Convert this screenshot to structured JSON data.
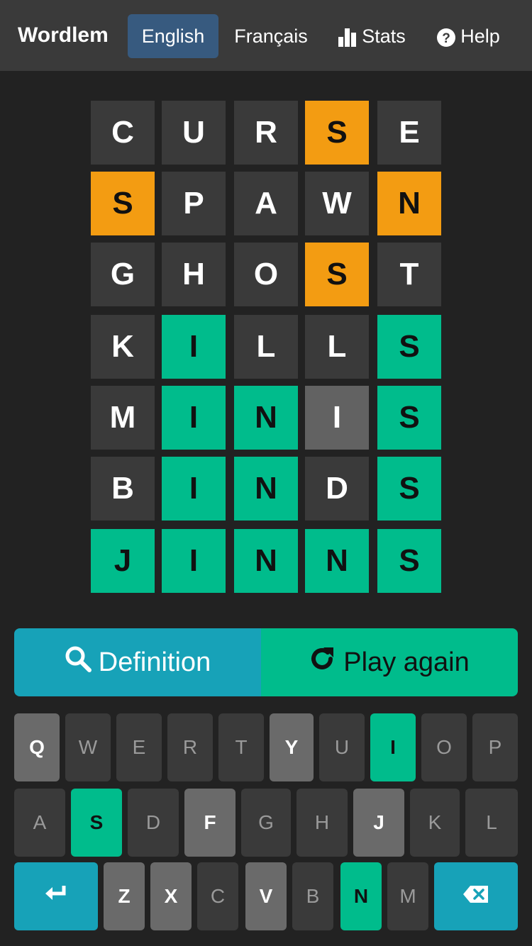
{
  "navbar": {
    "brand": "Wordlem",
    "links": [
      {
        "label": "English"
      },
      {
        "label": "Français"
      },
      {
        "label": "Stats",
        "icon": "bar-chart-icon"
      },
      {
        "label": "Help",
        "icon": "question-circle-icon"
      }
    ]
  },
  "board": {
    "rows": [
      [
        {
          "l": "C",
          "s": "absent"
        },
        {
          "l": "U",
          "s": "absent"
        },
        {
          "l": "R",
          "s": "absent"
        },
        {
          "l": "S",
          "s": "present"
        },
        {
          "l": "E",
          "s": "absent"
        }
      ],
      [
        {
          "l": "S",
          "s": "present"
        },
        {
          "l": "P",
          "s": "absent"
        },
        {
          "l": "A",
          "s": "absent"
        },
        {
          "l": "W",
          "s": "absent"
        },
        {
          "l": "N",
          "s": "present"
        }
      ],
      [
        {
          "l": "G",
          "s": "absent"
        },
        {
          "l": "H",
          "s": "absent"
        },
        {
          "l": "O",
          "s": "absent"
        },
        {
          "l": "S",
          "s": "present"
        },
        {
          "l": "T",
          "s": "absent"
        }
      ],
      [
        {
          "l": "K",
          "s": "absent"
        },
        {
          "l": "I",
          "s": "correct"
        },
        {
          "l": "L",
          "s": "absent"
        },
        {
          "l": "L",
          "s": "absent"
        },
        {
          "l": "S",
          "s": "correct"
        }
      ],
      [
        {
          "l": "M",
          "s": "absent"
        },
        {
          "l": "I",
          "s": "correct"
        },
        {
          "l": "N",
          "s": "correct"
        },
        {
          "l": "I",
          "s": "filled"
        },
        {
          "l": "S",
          "s": "correct"
        }
      ],
      [
        {
          "l": "B",
          "s": "absent"
        },
        {
          "l": "I",
          "s": "correct"
        },
        {
          "l": "N",
          "s": "correct"
        },
        {
          "l": "D",
          "s": "absent"
        },
        {
          "l": "S",
          "s": "correct"
        }
      ],
      [
        {
          "l": "J",
          "s": "correct"
        },
        {
          "l": "I",
          "s": "correct"
        },
        {
          "l": "N",
          "s": "correct"
        },
        {
          "l": "N",
          "s": "correct"
        },
        {
          "l": "S",
          "s": "correct"
        }
      ]
    ]
  },
  "actions": {
    "definition_label": "Definition",
    "definition_icon": "search-icon",
    "play_again_label": "Play again",
    "play_again_icon": "redo-icon"
  },
  "keyboard": {
    "rows": [
      [
        {
          "k": "Q",
          "s": "used"
        },
        {
          "k": "W",
          "s": "absent"
        },
        {
          "k": "E",
          "s": "absent"
        },
        {
          "k": "R",
          "s": "absent"
        },
        {
          "k": "T",
          "s": "absent"
        },
        {
          "k": "Y",
          "s": "used"
        },
        {
          "k": "U",
          "s": "absent"
        },
        {
          "k": "I",
          "s": "correct"
        },
        {
          "k": "O",
          "s": "absent"
        },
        {
          "k": "P",
          "s": "absent"
        }
      ],
      [
        {
          "k": "A",
          "s": "absent"
        },
        {
          "k": "S",
          "s": "correct"
        },
        {
          "k": "D",
          "s": "absent"
        },
        {
          "k": "F",
          "s": "used"
        },
        {
          "k": "G",
          "s": "absent"
        },
        {
          "k": "H",
          "s": "absent"
        },
        {
          "k": "J",
          "s": "used"
        },
        {
          "k": "K",
          "s": "absent"
        },
        {
          "k": "L",
          "s": "absent"
        }
      ],
      [
        {
          "k": "",
          "s": "action",
          "icon": "enter-icon"
        },
        {
          "k": "Z",
          "s": "used"
        },
        {
          "k": "X",
          "s": "used"
        },
        {
          "k": "C",
          "s": "absent"
        },
        {
          "k": "V",
          "s": "used"
        },
        {
          "k": "B",
          "s": "absent"
        },
        {
          "k": "N",
          "s": "correct"
        },
        {
          "k": "M",
          "s": "absent"
        },
        {
          "k": "",
          "s": "action",
          "icon": "backspace-icon"
        }
      ]
    ]
  },
  "colors": {
    "correct": "#00bc8c",
    "present": "#f39c12",
    "absent": "#3a3a3a",
    "accent": "#17a2b8",
    "nav_active": "#375a7f"
  }
}
